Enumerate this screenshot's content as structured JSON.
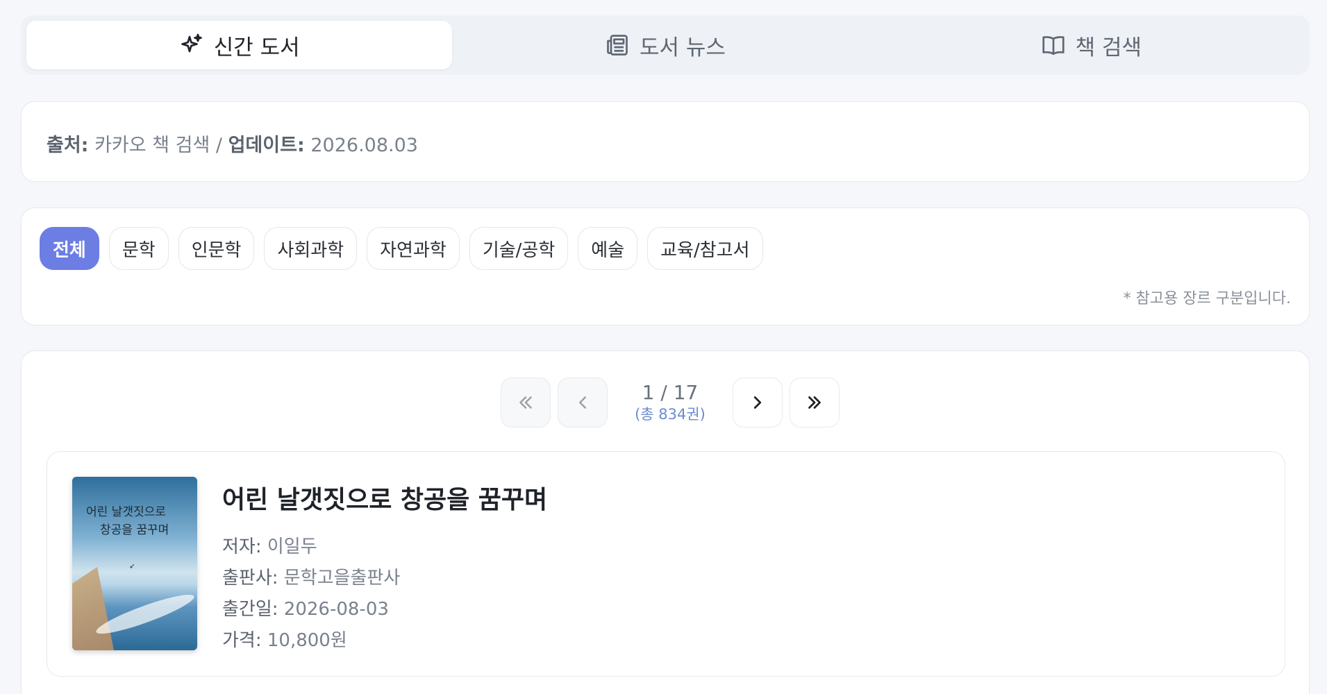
{
  "tabs": [
    {
      "label": "신간 도서",
      "icon": "sparkle-icon",
      "active": true
    },
    {
      "label": "도서 뉴스",
      "icon": "newspaper-icon",
      "active": false
    },
    {
      "label": "책 검색",
      "icon": "open-book-icon",
      "active": false
    }
  ],
  "source": {
    "source_key": "출처:",
    "source_value": "카카오 책 검색",
    "separator": "/",
    "update_key": "업데이트:",
    "update_value": "2026.08.03"
  },
  "genres": {
    "items": [
      "전체",
      "문학",
      "인문학",
      "사회과학",
      "자연과학",
      "기술/공학",
      "예술",
      "교육/참고서"
    ],
    "selected": "전체",
    "note": "* 참고용 장르 구분입니다."
  },
  "pagination": {
    "page_text": "1 / 17",
    "total_text": "(총 834권)"
  },
  "book": {
    "title": "어린 날갯짓으로 창공을 꿈꾸며",
    "cover_line1": "어린 날갯짓으로",
    "cover_line2": "창공을 꿈꾸며",
    "author_key": "저자:",
    "author": "이일두",
    "publisher_key": "출판사:",
    "publisher": "문학고을출판사",
    "date_key": "출간일:",
    "date": "2026-08-03",
    "price_key": "가격:",
    "price": "10,800원"
  },
  "colors": {
    "accent": "#6c7ee3",
    "total_text": "#6a8bd0"
  }
}
